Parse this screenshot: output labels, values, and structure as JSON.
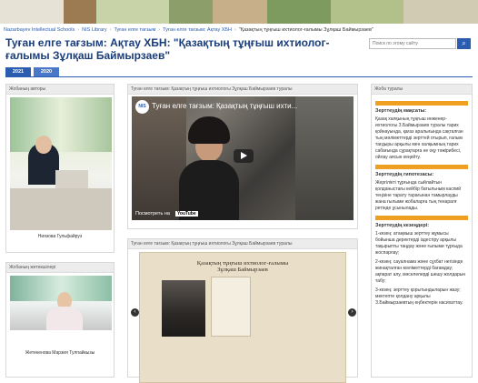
{
  "breadcrumbs": [
    "Nazarbayev Intellectual Schools",
    "NIS Library",
    "Туған елге тағзым",
    "Туған елге тағзым: Ақтау ХБН",
    "\"Қазақтың тұңғыш ихтиолог-ғалымы Зұлқаш Баймырзаев\""
  ],
  "page_title": "Туған елге тағзым: Ақтау ХБН: \"Қазақтың тұңғыш ихтиолог-ғалымы Зұлқаш Баймырзаев\"",
  "search": {
    "placeholder": "Поиск по этому сайту"
  },
  "year_tabs": [
    "2021",
    "2020"
  ],
  "left": {
    "author_header": "Жобаның авторы",
    "author_name": "Ниязова Гульфайруз",
    "supervisor_header": "Жобаның жетекшілері",
    "supervisor_name": "Жетекенова Марзия Тулпайкызы"
  },
  "center": {
    "video_header": "Туған елге тағзым: Қазақтың тұңғыш ихтиологы Зұлқаш Баймырзаев туралы",
    "video_title": "Туған елге тағзым: Қазақтың тұңғыш ихти...",
    "logo_text": "NIS",
    "watch_on": "Посмотреть на",
    "youtube": "YouTube",
    "slides_header": "Туған елге тағзым: Қазақтың тұңғыш ихтиологы Зұлқаш Баймырзаев туралы",
    "slide_title_line1": "Қазақтың тұңғыш ихтиолог-ғалымы",
    "slide_title_line2": "Зұлқаш Баймырзаев",
    "prev": "‹",
    "next": "›"
  },
  "right": {
    "header": "Жоба туралы",
    "s1_title": "Зерттеудің мақсаты:",
    "s1_text": "Қазақ халқының тұңғыш инженер-ихтиологы З.Баймырзаев туралы тарих қойнауында, қағаз аралығында сақталған тың мәліметтерді зерттей отырып, ғалым тағдыры арқылы мен халқымның тарих сабағында сұрақтарға не оқу тәжірибесі, ойлау аясын кеңейту.",
    "s2_title": "Зерттеудің гипотезасы:",
    "s2_text": "Жергілікті тұрғында сыйлайтын қолданыстағы кейбір батыльным каспий теңізіне тарату тарағынан тамырлауды жана ғылыми жобаларға тың тенаралғ ретінде ұсынылады.",
    "s3_title": "Зерттеудің кезеңдері:",
    "s3_text1": "1-кезең: атаңмыш зерттеу жұмысы бойынша деректерді іздестіру арқылы тақырыпты таңдау және ғылыми тұрғыда жоспарлау;",
    "s3_text2": "2-кезең: сауалнама және сұхбат негізінде жинақталған мәліметтерді бағамдау; ақпарат алу, мәселелерді шешу жолдарын табу;",
    "s3_text3": "3-кезең: зерттеу қорытындыларын жазу; мектепте қолдану арқылы З.Баймырзаевтың еңбектерін насихаттау."
  },
  "colors": {
    "accent": "#2a5db0",
    "orange": "#f0a020"
  }
}
